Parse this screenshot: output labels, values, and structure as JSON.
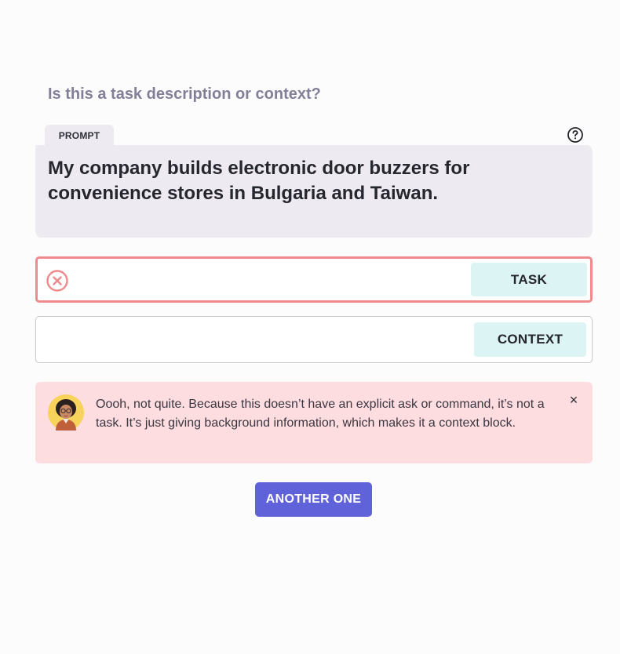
{
  "question": "Is this a task description or context?",
  "prompt": {
    "tab_label": "PROMPT",
    "text": "My company builds electronic door buzzers for convenience stores in Bulgaria and Taiwan."
  },
  "choices": {
    "task_label": "TASK",
    "context_label": "CONTEXT",
    "selected_state": "incorrect"
  },
  "feedback": {
    "message": "Oooh, not quite. Because this doesn’t have an explicit ask or command, it’s not a task. It’s just giving background information, which makes it a context block.",
    "close_symbol": "×"
  },
  "actions": {
    "another_label": "ANOTHER ONE"
  },
  "icons": {
    "help": "help-circle-icon",
    "wrong": "x-circle-icon",
    "close": "close-icon"
  },
  "colors": {
    "accent": "#5f62d8",
    "error": "#ee8a8c",
    "feedback_bg": "#fddde0",
    "choice_button_bg": "#dcf4f3",
    "prompt_bg": "#eeeaf1"
  }
}
